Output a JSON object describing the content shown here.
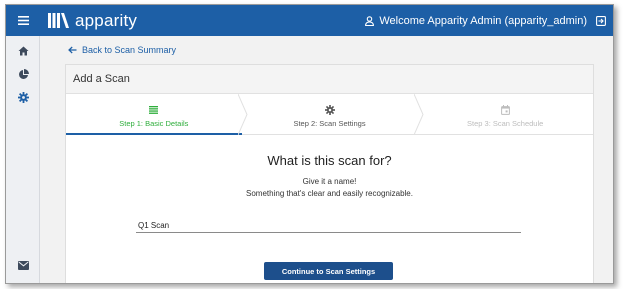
{
  "app": {
    "brand": "apparity",
    "welcome_text": "Welcome Apparity Admin (apparity_admin)"
  },
  "nav": {
    "icons": [
      "home-icon",
      "pie-chart-icon",
      "settings-icon",
      "mail-icon"
    ]
  },
  "breadcrumb": {
    "back_label": "Back to Scan Summary"
  },
  "card": {
    "title": "Add a Scan"
  },
  "steps": [
    {
      "label": "Step 1: Basic Details",
      "state": "active",
      "icon": "list-icon"
    },
    {
      "label": "Step 2: Scan Settings",
      "state": "normal",
      "icon": "gear-icon"
    },
    {
      "label": "Step 3: Scan Schedule",
      "state": "disabled",
      "icon": "calendar-icon"
    }
  ],
  "form": {
    "question": "What is this scan for?",
    "hint_line1": "Give it a name!",
    "hint_line2": "Something that's clear and easily recognizable.",
    "name_value": "Q1 Scan",
    "continue_label": "Continue to Scan Settings"
  },
  "colors": {
    "primary": "#1d5fa6",
    "button": "#1d4f8c",
    "active_step": "#2fae3c",
    "disabled_step": "#bdbdbd"
  }
}
